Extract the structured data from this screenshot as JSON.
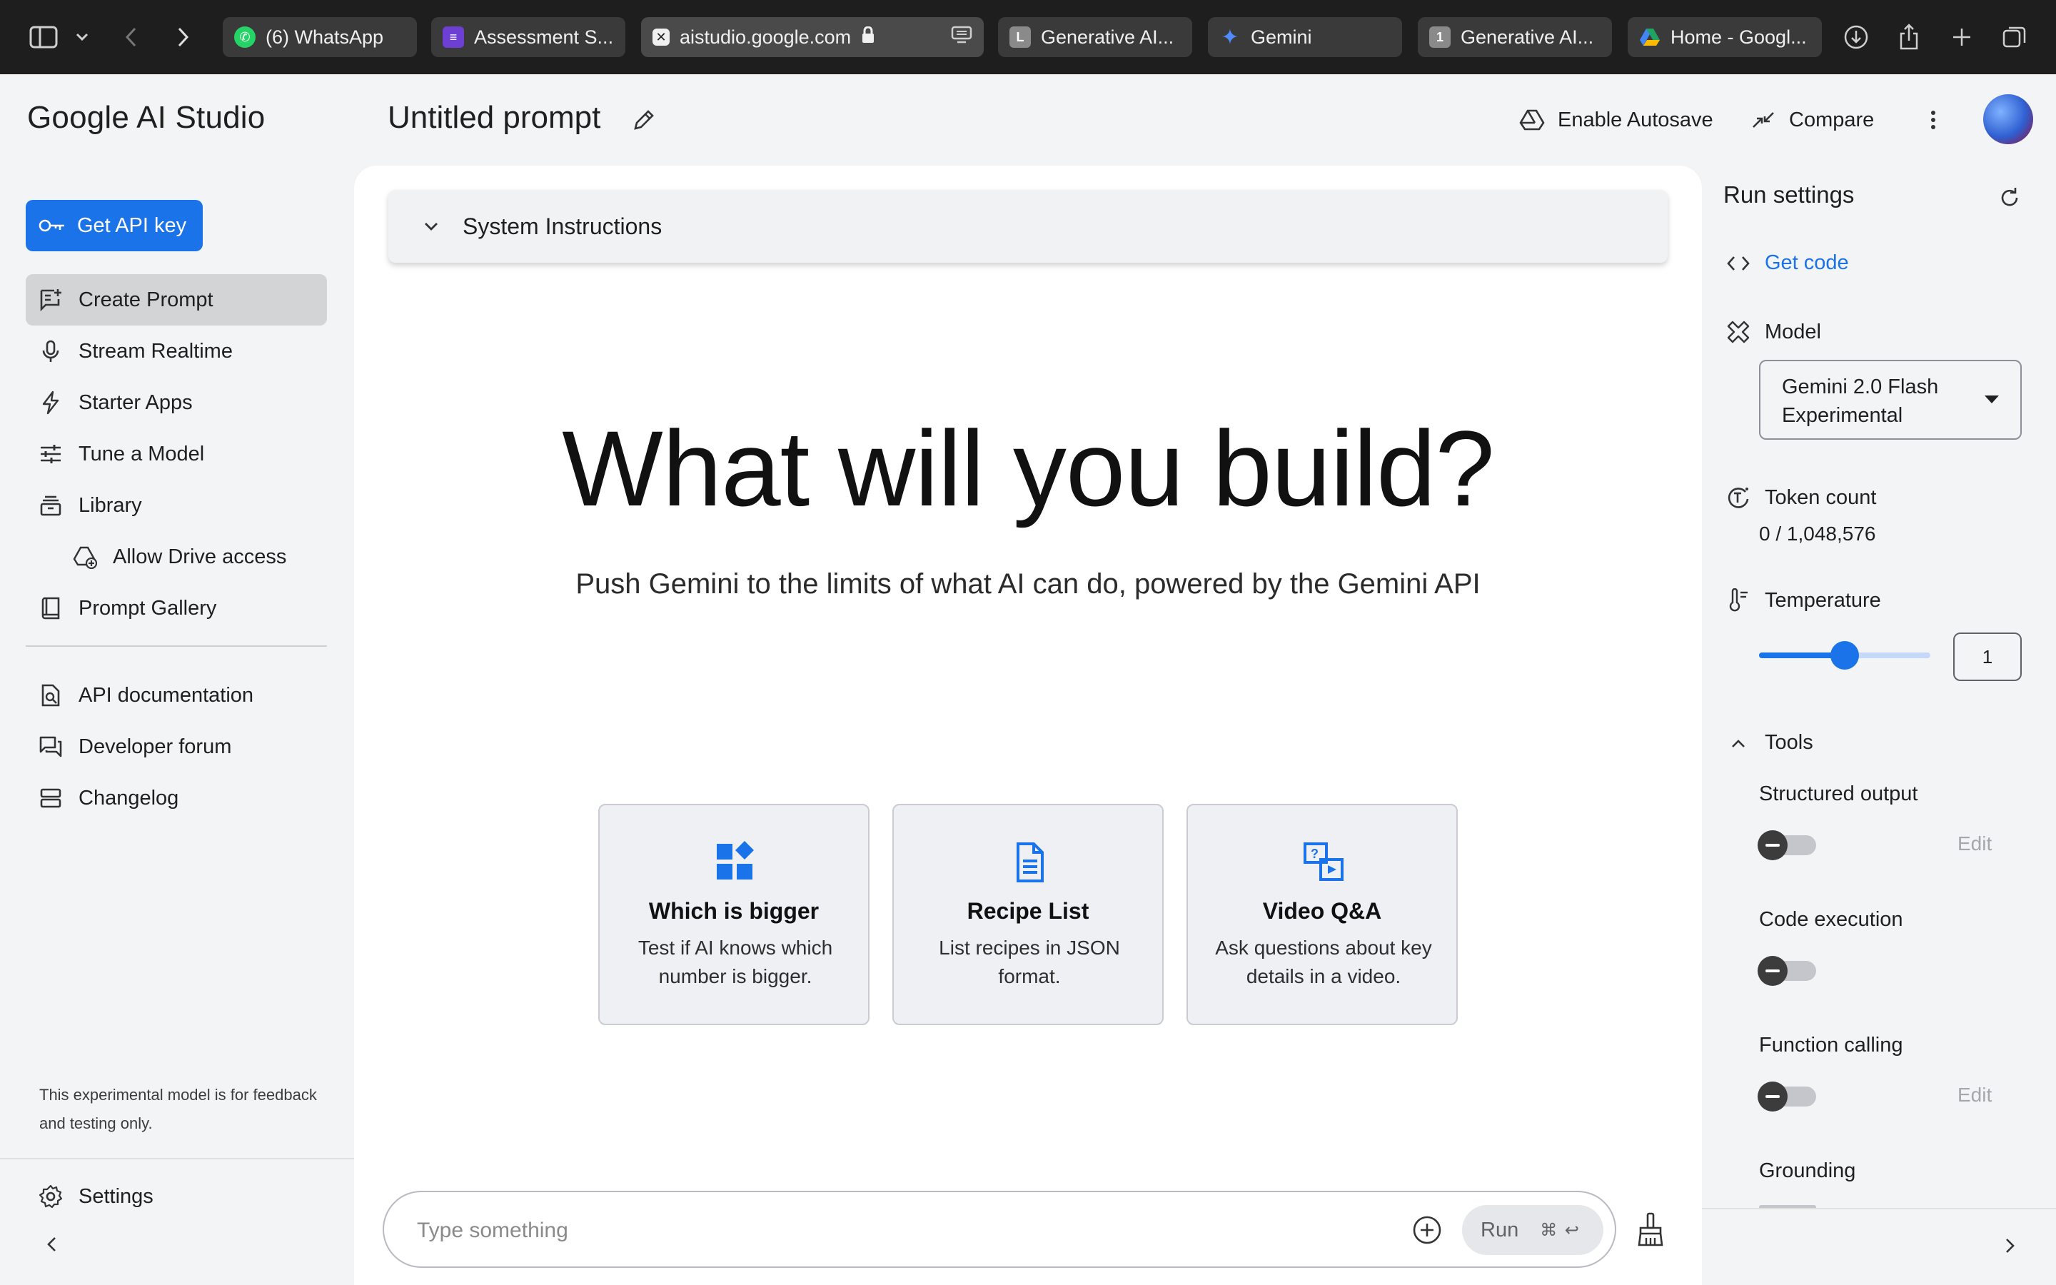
{
  "browser": {
    "tabs": [
      {
        "label": "(6) WhatsApp",
        "icon": "whatsapp-icon",
        "color": "#25d366"
      },
      {
        "label": "Assessment S...",
        "icon": "forms-icon",
        "color": "#6e3fd3"
      },
      {
        "label": "aistudio.google.com",
        "icon": "aistudio-icon",
        "color": "#ffffff"
      },
      {
        "label": "Generative AI...",
        "icon": "letter-l-icon",
        "color": "#8a8a8a"
      },
      {
        "label": "Gemini",
        "icon": "gemini-sparkle-icon",
        "color": "#4f8cff"
      },
      {
        "label": "Generative AI...",
        "icon": "letter-1-icon",
        "color": "#8a8a8a"
      },
      {
        "label": "Home - Googl...",
        "icon": "google-drive-icon",
        "color": "#1fa463"
      }
    ]
  },
  "app": {
    "name": "Google AI Studio",
    "prompt_title": "Untitled prompt",
    "enable_autosave": "Enable Autosave",
    "compare": "Compare"
  },
  "sidebar": {
    "api_key": "Get API key",
    "items": [
      {
        "label": "Create Prompt",
        "icon": "create-prompt-icon",
        "active": true
      },
      {
        "label": "Stream Realtime",
        "icon": "mic-icon"
      },
      {
        "label": "Starter Apps",
        "icon": "bolt-icon"
      },
      {
        "label": "Tune a Model",
        "icon": "tune-icon"
      },
      {
        "label": "Library",
        "icon": "library-icon"
      },
      {
        "label": "Allow Drive access",
        "icon": "drive-add-icon"
      },
      {
        "label": "Prompt Gallery",
        "icon": "book-icon"
      }
    ],
    "links": [
      {
        "label": "API documentation",
        "icon": "doc-search-icon"
      },
      {
        "label": "Developer forum",
        "icon": "forum-icon"
      },
      {
        "label": "Changelog",
        "icon": "changelog-icon"
      }
    ],
    "disclaimer": "This experimental model is for feedback and testing only.",
    "settings": "Settings"
  },
  "main": {
    "system_instructions": "System Instructions",
    "hero": "What will you build?",
    "subtitle": "Push Gemini to the limits of what AI can do, powered by the Gemini API",
    "cards": [
      {
        "title": "Which is bigger",
        "desc": "Test if AI knows which number is bigger.",
        "icon": "widgets-icon"
      },
      {
        "title": "Recipe List",
        "desc": "List recipes in JSON format.",
        "icon": "document-icon"
      },
      {
        "title": "Video Q&A",
        "desc": "Ask questions about key details in a video.",
        "icon": "video-qa-icon"
      }
    ],
    "composer_placeholder": "Type something",
    "run_label": "Run",
    "run_shortcut": "⌘ ↩"
  },
  "run_settings": {
    "title": "Run settings",
    "get_code": "Get code",
    "model_label": "Model",
    "model_value": "Gemini 2.0 Flash Experimental",
    "token_label": "Token count",
    "token_value": "0 / 1,048,576",
    "temperature_label": "Temperature",
    "temperature_value": "1",
    "temperature_fraction": 0.5,
    "tools_label": "Tools",
    "tools": [
      {
        "label": "Structured output",
        "enabled": false,
        "edit": "Edit"
      },
      {
        "label": "Code execution",
        "enabled": false,
        "edit": ""
      },
      {
        "label": "Function calling",
        "enabled": false,
        "edit": "Edit"
      },
      {
        "label": "Grounding",
        "enabled": false,
        "edit": ""
      }
    ]
  },
  "colors": {
    "accent": "#1a73e8",
    "chrome_bg": "#1e1e1e",
    "page_bg": "#f3f4f6"
  }
}
